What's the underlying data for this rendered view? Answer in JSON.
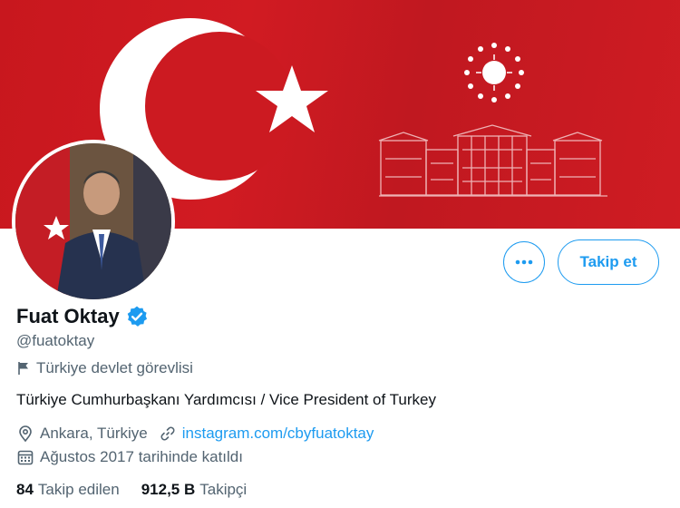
{
  "profile": {
    "display_name": "Fuat Oktay",
    "handle": "@fuatoktay",
    "label": "Türkiye devlet görevlisi",
    "bio": "Türkiye Cumhurbaşkanı Yardımcısı / Vice President of Turkey",
    "location": "Ankara, Türkiye",
    "website": "instagram.com/cbyfuatoktay",
    "joined": "Ağustos 2017 tarihinde katıldı"
  },
  "stats": {
    "following_count": "84",
    "following_label": "Takip edilen",
    "followers_count": "912,5 B",
    "followers_label": "Takipçi"
  },
  "actions": {
    "follow_label": "Takip et"
  },
  "icons": {
    "more": "more-horizontal-icon",
    "verified": "verified-badge-icon",
    "label": "flag-icon",
    "location": "location-pin-icon",
    "link": "link-icon",
    "calendar": "calendar-icon"
  },
  "colors": {
    "accent": "#1d9bf0",
    "banner_red": "#c8171e",
    "secondary_text": "#536471",
    "primary_text": "#0f1419"
  }
}
